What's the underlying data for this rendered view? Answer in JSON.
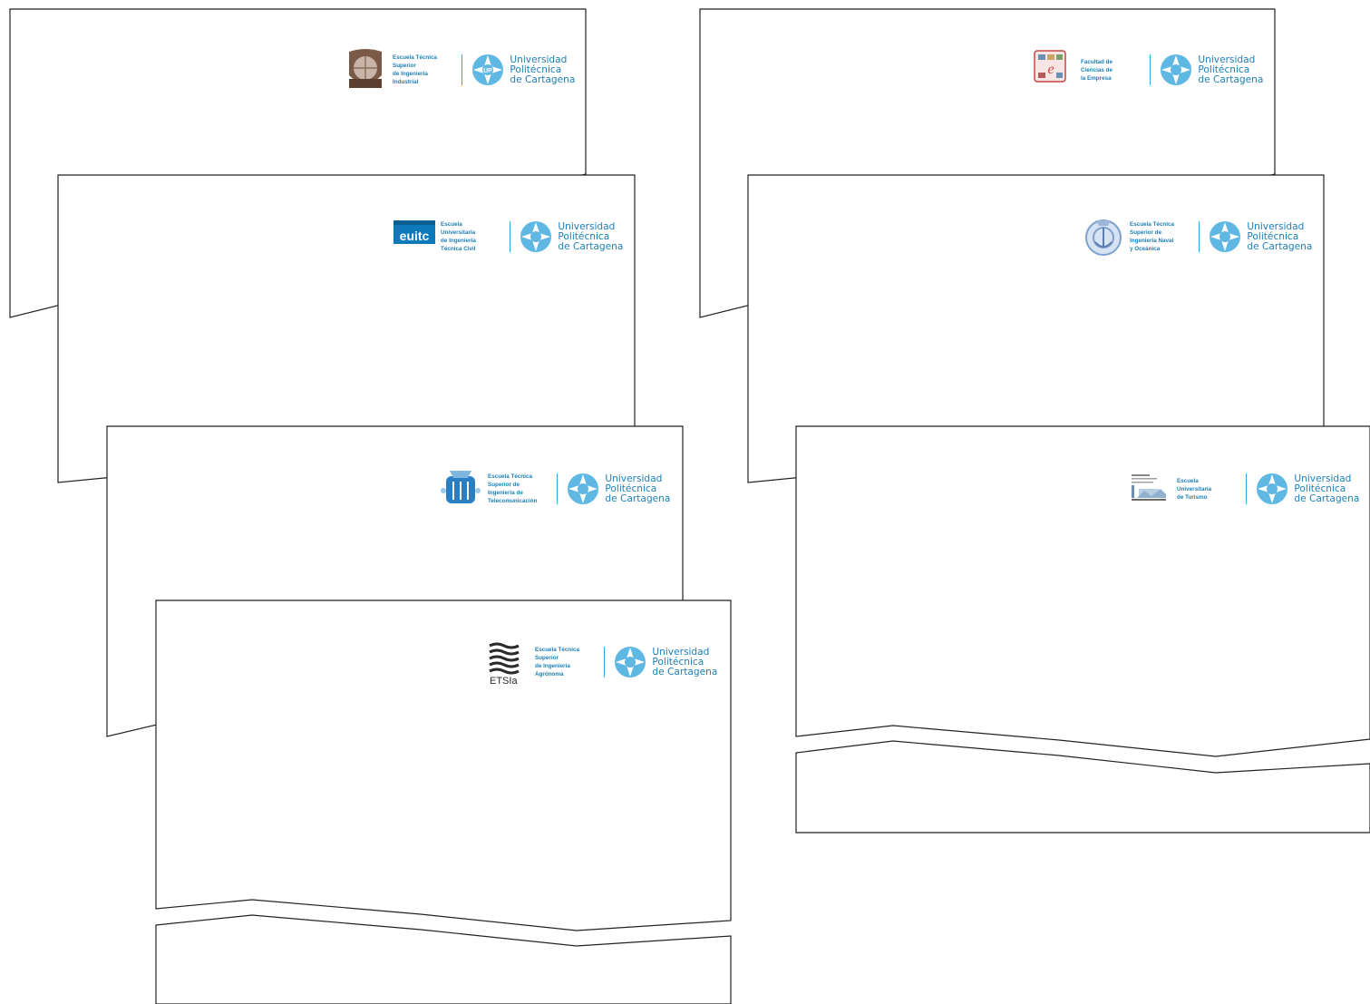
{
  "colors": {
    "brand": "#1d7fb6",
    "accent": "#33aadd",
    "outline": "#222222"
  },
  "university": {
    "line1": "Universidad",
    "line2": "Politécnica",
    "line3": "de Cartagena",
    "logo_icon": "upct-compass-star-icon"
  },
  "letterheads": [
    {
      "id": "industrial",
      "faculty_lines": [
        "Escuela Técnica",
        "Superior",
        "de Ingeniería",
        "Industrial"
      ],
      "emblem_icon": "etsii-shield-icon"
    },
    {
      "id": "civil",
      "faculty_lines": [
        "Escuela",
        "Universitaria",
        "de Ingeniería",
        "Técnica Civil"
      ],
      "emblem_icon": "euitc-logo-icon",
      "emblem_text": "euitc"
    },
    {
      "id": "teleco",
      "faculty_lines": [
        "Escuela Técnica",
        "Superior de",
        "Ingeniería de",
        "Telecomunicación"
      ],
      "emblem_icon": "etsit-crest-icon"
    },
    {
      "id": "agronoma",
      "faculty_lines": [
        "Escuela Técnica",
        "Superior",
        "de Ingeniería",
        "Agrónoma"
      ],
      "emblem_icon": "etsia-waves-icon",
      "emblem_text": "ETSIa"
    },
    {
      "id": "empresa",
      "faculty_lines": [
        "Facultad de",
        "Ciencias de",
        "la Empresa"
      ],
      "emblem_icon": "fce-tiles-icon",
      "emblem_text": "e"
    },
    {
      "id": "naval",
      "faculty_lines": [
        "Escuela Técnica",
        "Superior de",
        "Ingeniería Naval",
        "y Oceánica"
      ],
      "emblem_icon": "etsino-seal-icon"
    },
    {
      "id": "turismo",
      "faculty_lines": [
        "Escuela",
        "Universitaria",
        "de Turismo"
      ],
      "emblem_icon": "eut-building-icon"
    }
  ]
}
